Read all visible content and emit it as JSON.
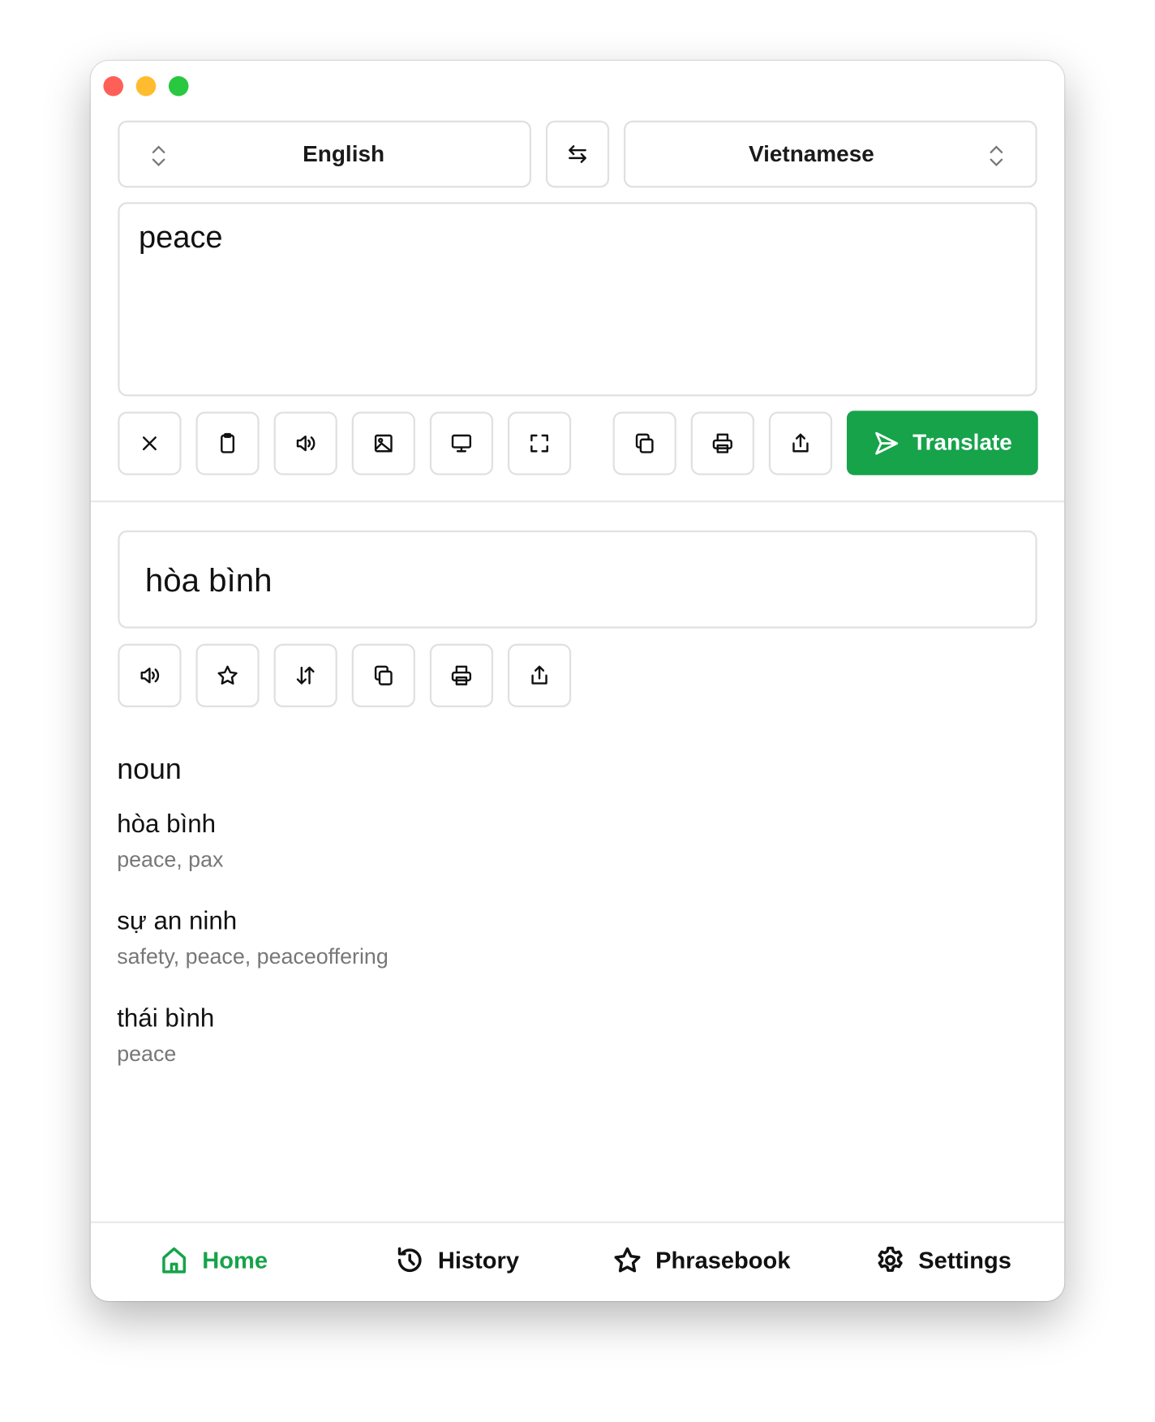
{
  "source_language": "English",
  "target_language": "Vietnamese",
  "input_text": "peace",
  "translate_label": "Translate",
  "result_text": "hòa bình",
  "part_of_speech": "noun",
  "definitions": [
    {
      "term": "hòa bình",
      "synonyms": "peace, pax"
    },
    {
      "term": "sự an ninh",
      "synonyms": "safety, peace, peaceoffering"
    },
    {
      "term": "thái bình",
      "synonyms": "peace"
    }
  ],
  "nav": [
    {
      "label": "Home",
      "icon": "home-icon",
      "active": true
    },
    {
      "label": "History",
      "icon": "history-icon"
    },
    {
      "label": "Phrasebook",
      "icon": "star-icon"
    },
    {
      "label": "Settings",
      "icon": "gear-icon"
    }
  ],
  "colors": {
    "accent": "#16a34a",
    "close": "#fe5f57",
    "minimize": "#febc2e",
    "zoom": "#28c840"
  }
}
